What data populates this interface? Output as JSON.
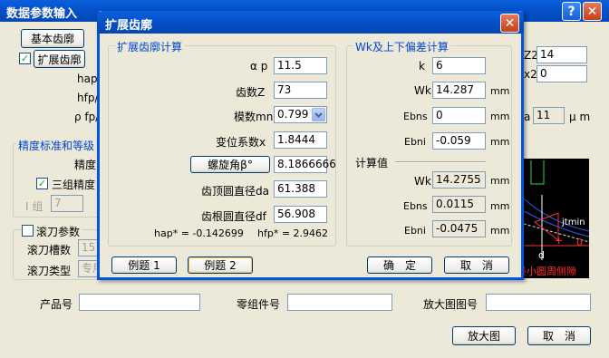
{
  "main": {
    "title": "数据参数输入",
    "help_glyph": "?",
    "close_glyph": "✕",
    "base_tooth": "基本齿廓",
    "ext_tooth": "扩展齿廓",
    "ext_checked": "✓",
    "hap_label": "hap/",
    "hfp_label": "hfp/",
    "rho_label": "ρ fp/",
    "z2_label": "Z2",
    "z2_value": "14",
    "x2_label": "x2",
    "x2_value": "0",
    "a_label": "a",
    "a_value": "11",
    "um_label": "μ m",
    "precision_title": "精度标准和等级",
    "precision_label": "精度",
    "three_group": "三组精度",
    "three_checked": "✓",
    "i_group": "I 组",
    "i_value": "7",
    "hob_param": "滚刀参数",
    "hob_slots_label": "滚刀槽数",
    "hob_slots_value": "15",
    "hob_type_label": "滚刀类型",
    "hob_type_value": "专用",
    "product_no": "产品号",
    "part_no": "零组件号",
    "zoom_drawing_no": "放大图图号",
    "zoom_button": "放大图",
    "cancel_button": "取　消",
    "preview_labels": {
      "jtmin": "jtmin",
      "zero": "0",
      "plus": "+",
      "d": "d",
      "min_arc": "最小圆周侧隙"
    }
  },
  "dialog": {
    "title": "扩展齿廓",
    "close_glyph": "✕",
    "left_group": "扩展齿廓计算",
    "alpha_p_label": "α p",
    "alpha_p": "11.5",
    "z_label": "齿数Z",
    "z": "73",
    "mn_label": "模数mn",
    "mn": "0.799",
    "x_label": "变位系数x",
    "x": "1.8444",
    "beta_button": "螺旋角β°",
    "beta": "8.1866666",
    "da_label": "齿顶圆直径da",
    "da": "61.388",
    "df_label": "齿根圆直径df",
    "df": "56.908",
    "hap_text": "hap* = -0.142699",
    "hfp_text": "hfp* = 2.9462",
    "right_group": "Wk及上下偏差计算",
    "k_label": "k",
    "k": "6",
    "wk_label": "Wk",
    "wk": "14.287",
    "ebns_label": "Ebns",
    "ebns": "0",
    "ebni_label": "Ebni",
    "ebni": "-0.059",
    "unit": "mm",
    "calc_title": "计算值",
    "wk_calc": "14.2755",
    "ebns_calc": "0.0115",
    "ebni_calc": "-0.0475",
    "example1": "例题 1",
    "example2": "例题 2",
    "ok": "确　定",
    "cancel": "取　消"
  }
}
